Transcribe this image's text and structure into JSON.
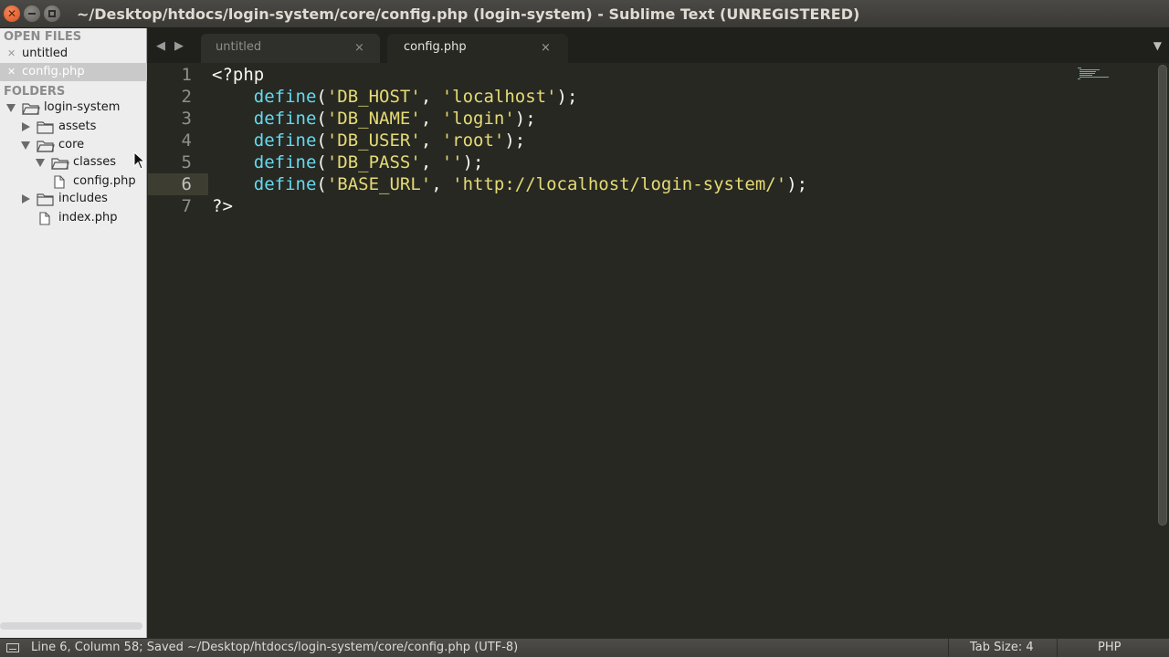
{
  "window": {
    "title": "~/Desktop/htdocs/login-system/core/config.php (login-system) - Sublime Text (UNREGISTERED)"
  },
  "sidebar": {
    "open_files_header": "OPEN FILES",
    "open_files": [
      {
        "name": "untitled",
        "active": false
      },
      {
        "name": "config.php",
        "active": true
      }
    ],
    "folders_header": "FOLDERS",
    "tree": [
      {
        "label": "login-system",
        "type": "folder",
        "expanded": true
      },
      {
        "label": "assets",
        "type": "folder",
        "expanded": false
      },
      {
        "label": "core",
        "type": "folder",
        "expanded": true
      },
      {
        "label": "classes",
        "type": "folder",
        "expanded": true
      },
      {
        "label": "config.php",
        "type": "file"
      },
      {
        "label": "includes",
        "type": "folder",
        "expanded": false
      },
      {
        "label": "index.php",
        "type": "file"
      }
    ]
  },
  "tabs": [
    {
      "label": "untitled",
      "active": false,
      "close": "×"
    },
    {
      "label": "config.php",
      "active": true,
      "close": "×"
    }
  ],
  "editor": {
    "current_line": 6,
    "lines": [
      {
        "num": "1",
        "tokens": [
          {
            "t": "<?php",
            "k": "tag"
          }
        ]
      },
      {
        "num": "2",
        "tokens": [
          {
            "t": "    ",
            "k": "punc"
          },
          {
            "t": "define",
            "k": "fn"
          },
          {
            "t": "(",
            "k": "punc"
          },
          {
            "t": "'DB_HOST'",
            "k": "str"
          },
          {
            "t": ", ",
            "k": "punc"
          },
          {
            "t": "'localhost'",
            "k": "str"
          },
          {
            "t": ");",
            "k": "punc"
          }
        ]
      },
      {
        "num": "3",
        "tokens": [
          {
            "t": "    ",
            "k": "punc"
          },
          {
            "t": "define",
            "k": "fn"
          },
          {
            "t": "(",
            "k": "punc"
          },
          {
            "t": "'DB_NAME'",
            "k": "str"
          },
          {
            "t": ", ",
            "k": "punc"
          },
          {
            "t": "'login'",
            "k": "str"
          },
          {
            "t": ");",
            "k": "punc"
          }
        ]
      },
      {
        "num": "4",
        "tokens": [
          {
            "t": "    ",
            "k": "punc"
          },
          {
            "t": "define",
            "k": "fn"
          },
          {
            "t": "(",
            "k": "punc"
          },
          {
            "t": "'DB_USER'",
            "k": "str"
          },
          {
            "t": ", ",
            "k": "punc"
          },
          {
            "t": "'root'",
            "k": "str"
          },
          {
            "t": ");",
            "k": "punc"
          }
        ]
      },
      {
        "num": "5",
        "tokens": [
          {
            "t": "    ",
            "k": "punc"
          },
          {
            "t": "define",
            "k": "fn"
          },
          {
            "t": "(",
            "k": "punc"
          },
          {
            "t": "'DB_PASS'",
            "k": "str"
          },
          {
            "t": ", ",
            "k": "punc"
          },
          {
            "t": "''",
            "k": "str"
          },
          {
            "t": ");",
            "k": "punc"
          }
        ]
      },
      {
        "num": "6",
        "tokens": [
          {
            "t": "    ",
            "k": "punc"
          },
          {
            "t": "define",
            "k": "fn"
          },
          {
            "t": "(",
            "k": "punc"
          },
          {
            "t": "'BASE_URL'",
            "k": "str"
          },
          {
            "t": ", ",
            "k": "punc"
          },
          {
            "t": "'http://localhost/login-system/'",
            "k": "str"
          },
          {
            "t": ");",
            "k": "punc"
          }
        ]
      },
      {
        "num": "7",
        "tokens": [
          {
            "t": "?>",
            "k": "tag"
          }
        ]
      }
    ]
  },
  "statusbar": {
    "position": "Line 6, Column 58; Saved ~/Desktop/htdocs/login-system/core/config.php (UTF-8)",
    "tab_size": "Tab Size: 4",
    "syntax": "PHP"
  },
  "colors": {
    "background": "#272822",
    "function": "#66d9ef",
    "string": "#e6db74",
    "foreground": "#f8f8f2",
    "close_button": "#dc4e1d"
  },
  "icons": {
    "window_close": "close-icon",
    "window_minimize": "minimize-icon",
    "window_maximize": "maximize-icon",
    "folder": "folder-icon",
    "file": "file-icon",
    "tab_nav_left": "chevron-left-icon",
    "tab_nav_right": "chevron-right-icon",
    "tab_menu": "chevron-down-icon",
    "status_panel": "panel-icon"
  }
}
